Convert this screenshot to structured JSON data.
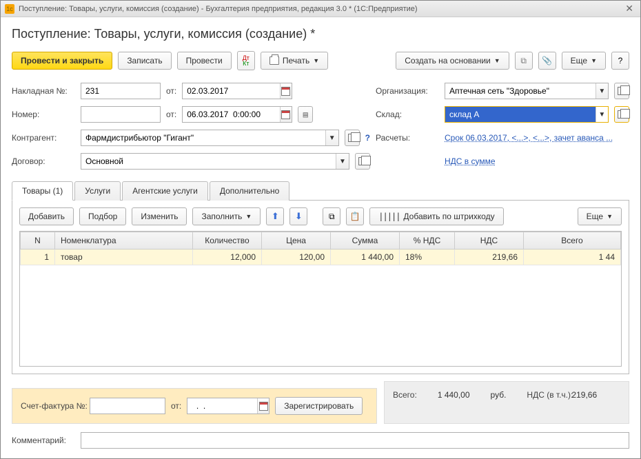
{
  "window": {
    "icon_text": "1c",
    "title": "Поступление: Товары, услуги, комиссия (создание) - Бухгалтерия предприятия, редакция 3.0 *  (1С:Предприятие)"
  },
  "page_title": "Поступление: Товары, услуги, комиссия (создание) *",
  "toolbar": {
    "post_close": "Провести и закрыть",
    "save": "Записать",
    "post": "Провести",
    "print": "Печать",
    "create_based": "Создать на основании",
    "more": "Еще",
    "help": "?"
  },
  "fields": {
    "invoice_no_label": "Накладная  №:",
    "invoice_no": "231",
    "from_label": "от:",
    "invoice_date": "02.03.2017",
    "org_label": "Организация:",
    "org": "Аптечная сеть \"Здоровье\"",
    "number_label": "Номер:",
    "number": "",
    "doc_date": "06.03.2017  0:00:00",
    "warehouse_label": "Склад:",
    "warehouse": "склад А",
    "counterparty_label": "Контрагент:",
    "counterparty": "Фармдистрибьютор \"Гигант\"",
    "calculations_label": "Расчеты:",
    "calculations_link": "Срок 06.03.2017, <...>, <...>, зачет аванса ...",
    "contract_label": "Договор:",
    "contract": "Основной",
    "vat_link": "НДС в сумме"
  },
  "tabs": {
    "goods": "Товары (1)",
    "services": "Услуги",
    "agent": "Агентские услуги",
    "extra": "Дополнительно"
  },
  "grid_toolbar": {
    "add": "Добавить",
    "pick": "Подбор",
    "edit": "Изменить",
    "fill": "Заполнить",
    "barcode": "Добавить по штрихкоду",
    "more": "Еще"
  },
  "grid": {
    "headers": {
      "n": "N",
      "nomenclature": "Номенклатура",
      "qty": "Количество",
      "price": "Цена",
      "sum": "Сумма",
      "vat_pct": "% НДС",
      "vat": "НДС",
      "total": "Всего"
    },
    "rows": [
      {
        "n": "1",
        "nomenclature": "товар",
        "qty": "12,000",
        "price": "120,00",
        "sum": "1 440,00",
        "vat_pct": "18%",
        "vat": "219,66",
        "total": "1 44"
      }
    ]
  },
  "invoice": {
    "label": "Счет-фактура №:",
    "from_label": "от:",
    "date": "  .  .",
    "register": "Зарегистрировать"
  },
  "totals": {
    "total_label": "Всего:",
    "total": "1 440,00",
    "currency": "руб.",
    "vat_label": "НДС (в т.ч.):",
    "vat": "219,66"
  },
  "comment_label": "Комментарий:"
}
